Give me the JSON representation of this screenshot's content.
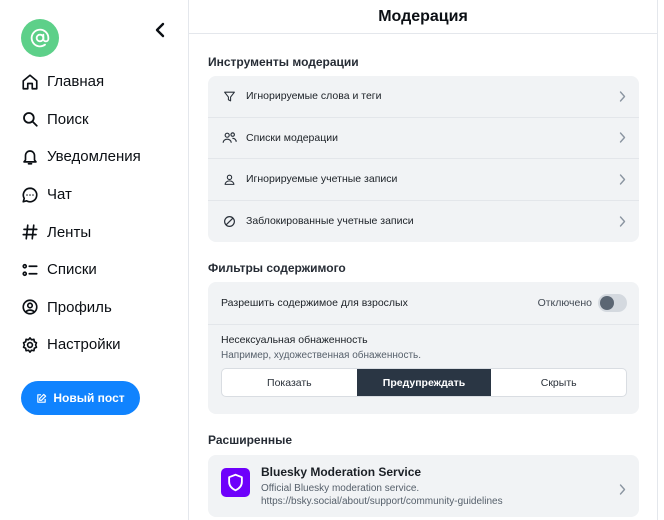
{
  "nav": {
    "collapse_icon": "chevron-left-icon",
    "avatar_icon": "at-sign-icon",
    "items": [
      {
        "label": "Главная",
        "icon": "home-icon"
      },
      {
        "label": "Поиск",
        "icon": "search-icon"
      },
      {
        "label": "Уведомления",
        "icon": "bell-icon"
      },
      {
        "label": "Чат",
        "icon": "chat-bubble-icon"
      },
      {
        "label": "Ленты",
        "icon": "hash-icon"
      },
      {
        "label": "Списки",
        "icon": "list-icon"
      },
      {
        "label": "Профиль",
        "icon": "user-circle-icon"
      },
      {
        "label": "Настройки",
        "icon": "gear-icon"
      }
    ],
    "new_post_label": "Новый пост"
  },
  "page": {
    "title": "Модерация"
  },
  "tools": {
    "title": "Инструменты модерации",
    "items": [
      {
        "label": "Игнорируемые слова и теги",
        "icon": "filter-icon"
      },
      {
        "label": "Списки модерации",
        "icon": "users-icon"
      },
      {
        "label": "Игнорируемые учетные записи",
        "icon": "person-icon"
      },
      {
        "label": "Заблокированные учетные записи",
        "icon": "block-icon"
      }
    ]
  },
  "filters": {
    "title": "Фильтры содержимого",
    "adult_label": "Разрешить содержимое для взрослых",
    "adult_state": "Отключено",
    "adult_enabled": false,
    "nudity_title": "Несексуальная обнаженность",
    "nudity_sub": "Например, художественная обнаженность.",
    "options": [
      "Показать",
      "Предупреждать",
      "Скрыть"
    ],
    "selected": "Предупреждать"
  },
  "advanced": {
    "title": "Расширенные",
    "service_name": "Bluesky Moderation Service",
    "service_desc": "Official Bluesky moderation service.",
    "service_url": "https://bsky.social/about/support/community-guidelines"
  },
  "colors": {
    "accent": "#1083fe",
    "avatar": "#5dd089",
    "service_logo": "#6e00fb",
    "segment_active": "#2a3644"
  }
}
